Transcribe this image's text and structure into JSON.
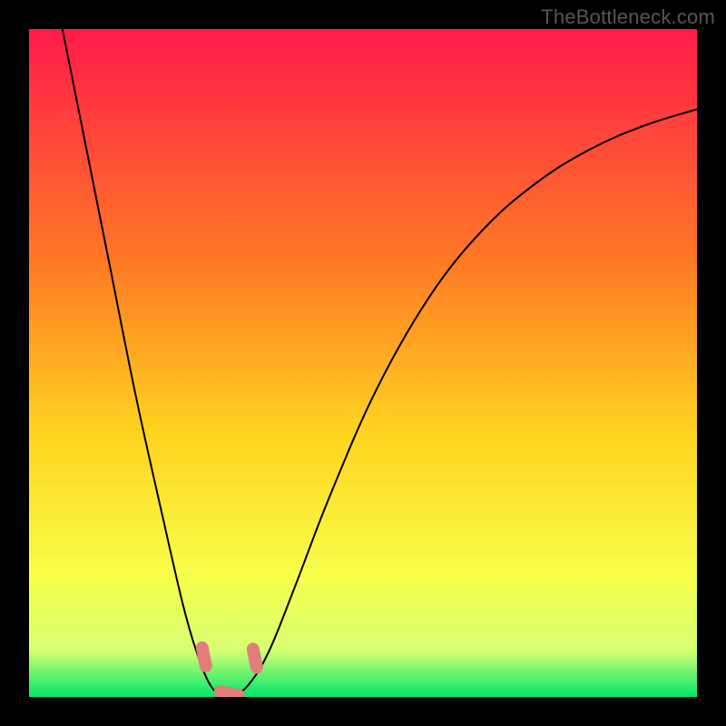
{
  "attribution": "TheBottleneck.com",
  "colors": {
    "gradient_top": "#ff1b4b",
    "gradient_upper_mid": "#ff7a25",
    "gradient_mid": "#ffd21f",
    "gradient_lower_mid": "#f7ff4a",
    "gradient_lower_band": "#d7ff73",
    "gradient_bottom": "#00e76a",
    "curve_stroke": "#000000",
    "marker_stroke": "#e17e7a",
    "frame_bg": "#000000"
  },
  "chart_data": {
    "type": "line",
    "title": "",
    "xlabel": "",
    "ylabel": "",
    "xlim": [
      0,
      100
    ],
    "ylim": [
      0,
      100
    ],
    "grid": false,
    "legend": false,
    "series": [
      {
        "name": "curve",
        "x": [
          5,
          8,
          12,
          16,
          20,
          23,
          25,
          27,
          29,
          30.5,
          33,
          36,
          40,
          45,
          52,
          60,
          68,
          76,
          84,
          92,
          100
        ],
        "y": [
          100,
          85,
          65,
          45,
          27,
          14,
          7,
          2,
          0,
          0,
          2,
          7,
          17,
          30,
          46,
          60,
          70,
          77,
          82,
          85.5,
          88
        ]
      }
    ],
    "annotations": [
      {
        "name": "marker-left",
        "x": 26.2,
        "y": 6.0
      },
      {
        "name": "marker-bottom",
        "x": 30.0,
        "y": 0.5
      },
      {
        "name": "marker-right",
        "x": 33.8,
        "y": 5.8
      }
    ]
  }
}
